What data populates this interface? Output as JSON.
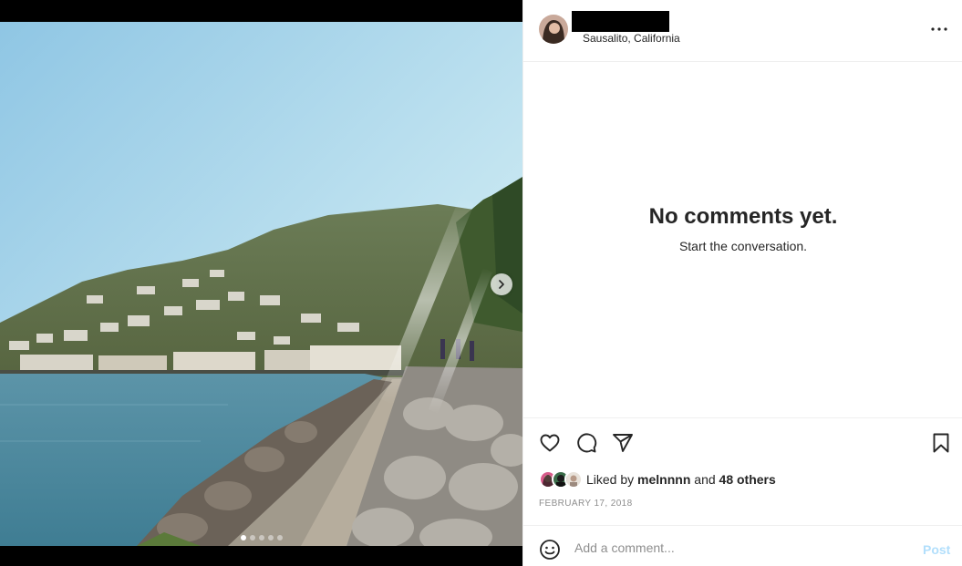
{
  "post": {
    "location": "Sausalito, California",
    "date": "FEBRUARY 17, 2018",
    "carousel": {
      "slide_count": 5,
      "active_index": 0
    }
  },
  "comments": {
    "empty_title": "No comments yet.",
    "empty_subtitle": "Start the conversation."
  },
  "likes": {
    "prefix": "Liked by",
    "first_liker": "melnnnn",
    "conjunction": "and",
    "others": "48 others"
  },
  "composer": {
    "placeholder": "Add a comment...",
    "post_label": "Post"
  },
  "icons": {
    "more": "more-horizontal-icon",
    "like": "heart-icon",
    "comment": "comment-bubble-icon",
    "share": "paper-plane-icon",
    "save": "bookmark-icon",
    "emoji": "smiley-icon",
    "next": "chevron-right-icon"
  },
  "colors": {
    "post_disabled": "#b2dffc",
    "meta_gray": "#8e8e8e",
    "divider": "#efefef"
  }
}
